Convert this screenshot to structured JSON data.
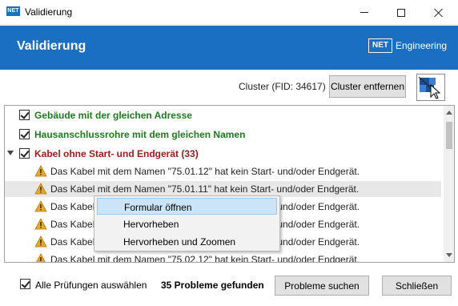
{
  "window": {
    "title": "Validierung",
    "app_logo": "NET",
    "icons": {
      "minimize": "minimize-icon",
      "maximize": "maximize-icon",
      "close": "close-icon"
    }
  },
  "header": {
    "title": "Validierung",
    "brand_logo": "NET",
    "brand_text": "Engineering",
    "background": "#1b6fc2"
  },
  "cluster": {
    "label": "Cluster (FID: 34617)",
    "remove_button": "Cluster entfernen",
    "select_tool_icon": "map-select-cursor-icon"
  },
  "tree": {
    "categories": [
      {
        "label": "Gebäude mit der gleichen Adresse",
        "checked": true,
        "color": "#1e7a1e"
      },
      {
        "label": "Hausanschlussrohre mit dem gleichen Namen",
        "checked": true,
        "color": "#1e7a1e"
      },
      {
        "label": "Kabel ohne Start- und Endgerät (33)",
        "checked": true,
        "expanded": true,
        "color": "#9b1b1b"
      }
    ],
    "issues": [
      {
        "text": "Das Kabel mit dem Namen \"75.01.12\" hat kein Start- und/oder Endgerät."
      },
      {
        "text": "Das Kabel mit dem Namen \"75.01.11\" hat kein Start- und/oder Endgerät."
      },
      {
        "text": "Das Kabel mit dem Namen \"75.01.10\" hat kein Start- und/oder Endgerät."
      },
      {
        "text": "Das Kabel mit dem Namen \"75.01.09\" hat kein Start- und/oder Endgerät."
      },
      {
        "text": "Das Kabel mit dem Namen \"75.02.13\" hat kein Start- und/oder Endgerät."
      },
      {
        "text": "Das Kabel mit dem Namen \"75.02.12\" hat kein Start- und/oder Endgerät."
      }
    ],
    "warning_icon": "warning-icon"
  },
  "context_menu": {
    "items": [
      {
        "label": "Formular öffnen",
        "highlighted": true
      },
      {
        "label": "Hervorheben"
      },
      {
        "label": "Hervorheben und Zoomen"
      }
    ]
  },
  "footer": {
    "select_all_label": "Alle Prüfungen auswählen",
    "select_all_checked": true,
    "problem_count": "35 Probleme gefunden",
    "search_button": "Probleme suchen",
    "close_button": "Schließen"
  }
}
